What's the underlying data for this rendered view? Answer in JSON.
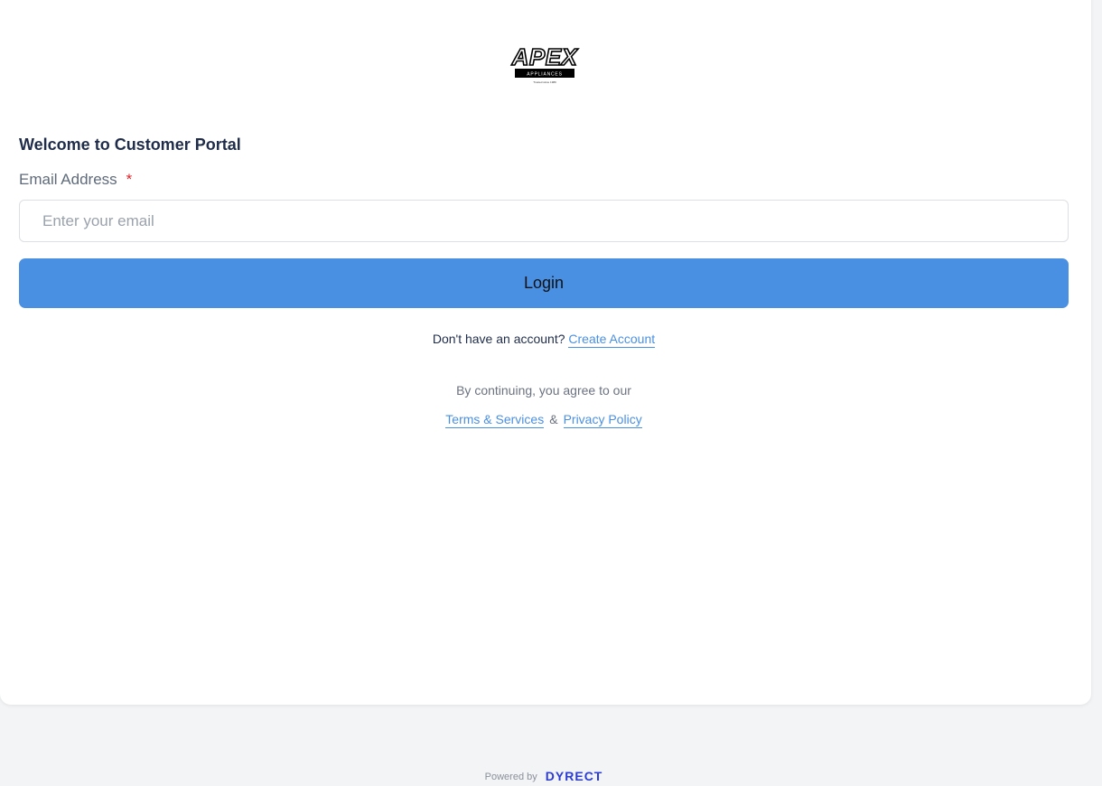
{
  "logo": {
    "name": "APEX",
    "sub": "APPLIANCES",
    "tagline": "Trusted since 1989"
  },
  "form": {
    "title": "Welcome to Customer Portal",
    "email_label": "Email Address",
    "required_mark": "*",
    "email_placeholder": "Enter your email",
    "email_value": "",
    "login_label": "Login"
  },
  "signup": {
    "prompt": "Don't have an account?",
    "link": "Create Account"
  },
  "legal": {
    "agree_text": "By continuing, you agree to our",
    "terms": "Terms & Services",
    "amp": "&",
    "privacy": "Privacy Policy"
  },
  "footer": {
    "powered_by": "Powered by",
    "brand": "DYRECT"
  },
  "colors": {
    "accent": "#4a90e2",
    "required": "#d9262c",
    "brand": "#2a3bd6",
    "page_bg": "#f3f4f6"
  }
}
